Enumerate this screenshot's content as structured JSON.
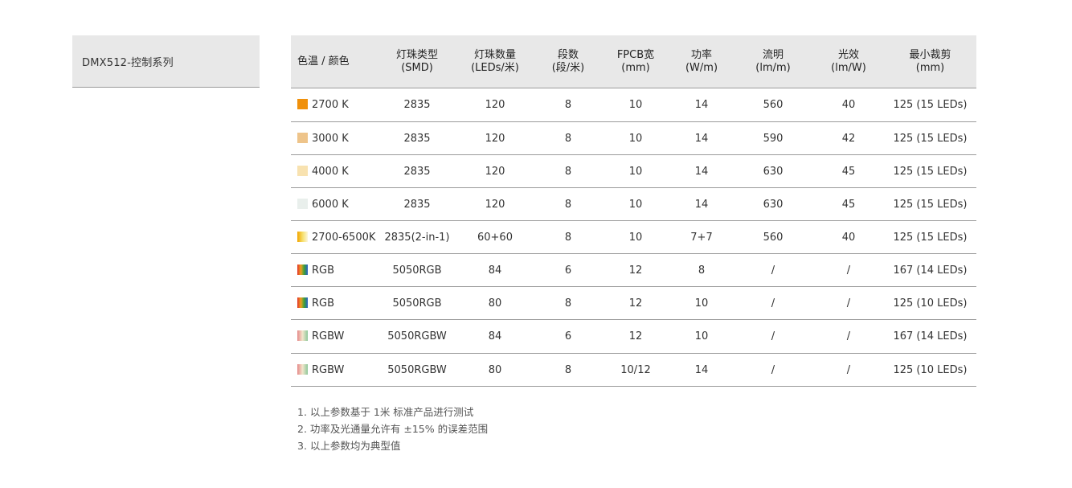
{
  "section_title": "DMX512-控制系列",
  "columns": [
    {
      "line1": "色温 / 颜色",
      "line2": ""
    },
    {
      "line1": "灯珠类型",
      "line2": "(SMD)"
    },
    {
      "line1": "灯珠数量",
      "line2": "(LEDs/米)"
    },
    {
      "line1": "段数",
      "line2": "(段/米)"
    },
    {
      "line1": "FPCB宽",
      "line2": "(mm)"
    },
    {
      "line1": "功率",
      "line2": "(W/m)"
    },
    {
      "line1": "流明",
      "line2": "(lm/m)"
    },
    {
      "line1": "光效",
      "line2": "(lm/W)"
    },
    {
      "line1": "最小裁剪",
      "line2": "(mm)"
    }
  ],
  "rows": [
    {
      "color": "2700 K",
      "swatch": {
        "style": "solid",
        "colors": [
          "#f0900a"
        ]
      },
      "smd": "2835",
      "leds": "120",
      "segments": "8",
      "fpcb": "10",
      "power": "14",
      "lumen": "560",
      "efficacy": "40",
      "cut": "125 (15 LEDs)"
    },
    {
      "color": "3000 K",
      "swatch": {
        "style": "solid",
        "colors": [
          "#eec48a"
        ]
      },
      "smd": "2835",
      "leds": "120",
      "segments": "8",
      "fpcb": "10",
      "power": "14",
      "lumen": "590",
      "efficacy": "42",
      "cut": "125 (15 LEDs)"
    },
    {
      "color": "4000 K",
      "swatch": {
        "style": "solid",
        "colors": [
          "#f8e2b0"
        ]
      },
      "smd": "2835",
      "leds": "120",
      "segments": "8",
      "fpcb": "10",
      "power": "14",
      "lumen": "630",
      "efficacy": "45",
      "cut": "125 (15 LEDs)"
    },
    {
      "color": "6000 K",
      "swatch": {
        "style": "solid",
        "colors": [
          "#e9efec"
        ]
      },
      "smd": "2835",
      "leds": "120",
      "segments": "8",
      "fpcb": "10",
      "power": "14",
      "lumen": "630",
      "efficacy": "45",
      "cut": "125 (15 LEDs)"
    },
    {
      "color": "2700-6500K",
      "swatch": {
        "style": "gradient",
        "colors": [
          "#f2a500",
          "#f6df6a",
          "#fbf6dc"
        ]
      },
      "smd": "2835(2-in-1)",
      "leds": "60+60",
      "segments": "8",
      "fpcb": "10",
      "power": "7+7",
      "lumen": "560",
      "efficacy": "40",
      "cut": "125 (15 LEDs)"
    },
    {
      "color": "RGB",
      "swatch": {
        "style": "gradient",
        "colors": [
          "#e0312a",
          "#f0a020",
          "#3aa03a",
          "#2a5fc8"
        ]
      },
      "smd": "5050RGB",
      "leds": "84",
      "segments": "6",
      "fpcb": "12",
      "power": "8",
      "lumen": "/",
      "efficacy": "/",
      "cut": "167 (14 LEDs)"
    },
    {
      "color": "RGB",
      "swatch": {
        "style": "gradient",
        "colors": [
          "#e0312a",
          "#f0a020",
          "#3aa03a",
          "#2a5fc8"
        ]
      },
      "smd": "5050RGB",
      "leds": "80",
      "segments": "8",
      "fpcb": "12",
      "power": "10",
      "lumen": "/",
      "efficacy": "/",
      "cut": "125 (10 LEDs)"
    },
    {
      "color": "RGBW",
      "swatch": {
        "style": "gradient",
        "colors": [
          "#e58a8a",
          "#f2e6cc",
          "#8fc89a"
        ]
      },
      "smd": "5050RGBW",
      "leds": "84",
      "segments": "6",
      "fpcb": "12",
      "power": "10",
      "lumen": "/",
      "efficacy": "/",
      "cut": "167 (14 LEDs)"
    },
    {
      "color": "RGBW",
      "swatch": {
        "style": "gradient",
        "colors": [
          "#e58a8a",
          "#f2e6cc",
          "#8fc89a"
        ]
      },
      "smd": "5050RGBW",
      "leds": "80",
      "segments": "8",
      "fpcb": "10/12",
      "power": "14",
      "lumen": "/",
      "efficacy": "/",
      "cut": "125 (10 LEDs)"
    }
  ],
  "notes": [
    "1. 以上参数基于 1米 标准产品进行测试",
    "2. 功率及光通量允许有 ±15% 的误差范围",
    "3. 以上参数均为典型值"
  ]
}
